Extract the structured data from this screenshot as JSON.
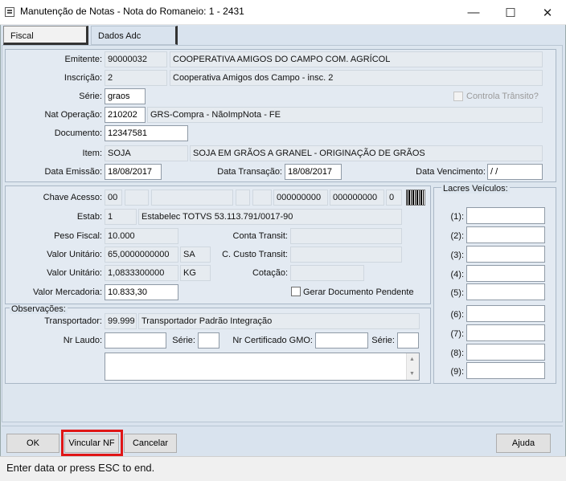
{
  "window": {
    "title": "Manutenção de Notas - Nota do Romaneio: 1 - 2431",
    "minimize": "—",
    "maximize": "☐",
    "close": "✕"
  },
  "tabs": [
    {
      "label": "Fiscal",
      "active": true
    },
    {
      "label": "Dados Adc",
      "active": false
    }
  ],
  "header": {
    "emitente_label": "Emitente:",
    "emitente_code": "90000032",
    "emitente_name": "COOPERATIVA AMIGOS DO CAMPO COM. AGRÍCOL",
    "inscricao_label": "Inscrição:",
    "inscricao_code": "2",
    "inscricao_name": "Cooperativa Amigos dos Campo - insc. 2",
    "serie_label": "Série:",
    "serie_value": "graos",
    "controla_label": "Controla Trânsito?",
    "natop_label": "Nat Operação:",
    "natop_code": "210202",
    "natop_desc": "GRS-Compra - NãoImpNota - FE",
    "documento_label": "Documento:",
    "documento_value": "12347581",
    "item_label": "Item:",
    "item_code": "SOJA",
    "item_desc": "SOJA EM GRÃOS A GRANEL - ORIGINAÇÃO DE GRÃOS",
    "data_emissao_label": "Data Emissão:",
    "data_emissao_value": "18/08/2017",
    "data_transacao_label": "Data Transação:",
    "data_transacao_value": "18/08/2017",
    "data_vencimento_label": "Data Vencimento:",
    "data_vencimento_value": " /  /"
  },
  "detail": {
    "chave_label": "Chave Acesso:",
    "chave_1": "00",
    "chave_zeros_1": "000000000",
    "chave_zeros_2": "000000000",
    "chave_last": "0",
    "estab_label": "Estab:",
    "estab_code": "1",
    "estab_name": "Estabelec TOTVS 53.113.791/0017-90",
    "peso_label": "Peso Fiscal:",
    "peso_value": "10.000",
    "conta_transit_label": "Conta Transit:",
    "valor_unit_1_label": "Valor Unitário:",
    "valor_unit_1_value": "65,0000000000",
    "valor_unit_1_unit": "SA",
    "ccusto_label": "C. Custo Transit:",
    "valor_unit_2_label": "Valor Unitário:",
    "valor_unit_2_value": "1,0833300000",
    "valor_unit_2_unit": "KG",
    "cotacao_label": "Cotação:",
    "valor_merc_label": "Valor Mercadoria:",
    "valor_merc_value": "10.833,30",
    "gerar_label": "Gerar Documento Pendente"
  },
  "obs": {
    "group_label": "Observações:",
    "transp_label": "Transportador:",
    "transp_code": "99.999",
    "transp_name": "Transportador Padrão Integração",
    "laudo_label": "Nr Laudo:",
    "serie_label_1": "Série:",
    "gmo_label": "Nr Certificado GMO:",
    "serie_label_2": "Série:"
  },
  "lacres": {
    "group_label": "Lacres Veículos:",
    "items": [
      "(1):",
      "(2):",
      "(3):",
      "(4):",
      "(5):",
      "(6):",
      "(7):",
      "(8):",
      "(9):"
    ]
  },
  "buttons": {
    "ok": "OK",
    "vincular": "Vincular NF",
    "cancelar": "Cancelar",
    "ajuda": "Ajuda"
  },
  "status": "Enter data or press ESC to end."
}
